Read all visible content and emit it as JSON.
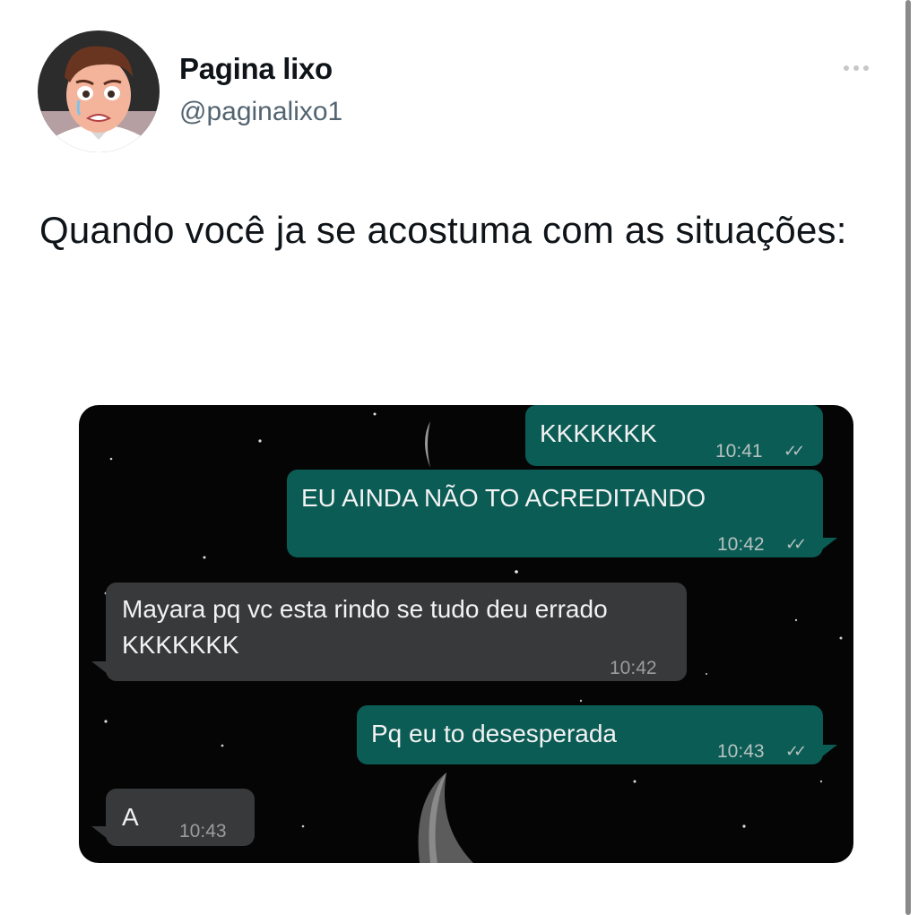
{
  "tweet": {
    "display_name": "Pagina lixo",
    "handle": "@paginalixo1",
    "text": "Quando você ja se acostuma com as situações:"
  },
  "chat": {
    "messages": [
      {
        "direction": "outgoing",
        "text": "KKKKKKK",
        "time": "10:41",
        "status": "read"
      },
      {
        "direction": "outgoing",
        "text": "EU AINDA NÃO TO ACREDITANDO",
        "time": "10:42",
        "status": "read"
      },
      {
        "direction": "incoming",
        "text": "Mayara pq vc esta rindo se tudo deu errado KKKKKKK",
        "time": "10:42"
      },
      {
        "direction": "outgoing",
        "text": "Pq eu to desesperada",
        "time": "10:43",
        "status": "read"
      },
      {
        "direction": "incoming",
        "text": "A",
        "time": "10:43"
      }
    ]
  },
  "colors": {
    "outgoing_bubble": "#0b5c55",
    "incoming_bubble": "#38393b",
    "chat_background": "#050505"
  }
}
